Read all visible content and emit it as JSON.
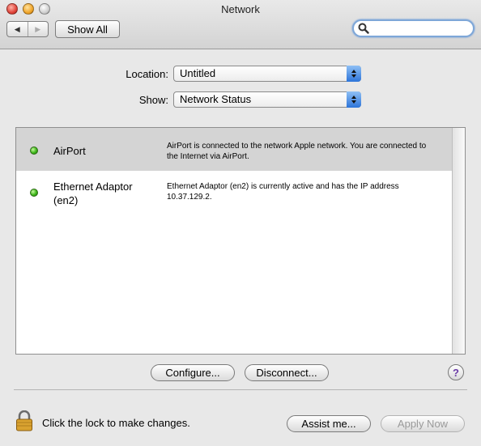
{
  "window": {
    "title": "Network"
  },
  "toolbar": {
    "back_arrow": "◀",
    "forward_arrow": "▶",
    "show_all_label": "Show All",
    "search_placeholder": ""
  },
  "location": {
    "label": "Location:",
    "value": "Untitled"
  },
  "show": {
    "label": "Show:",
    "value": "Network Status"
  },
  "status_list": [
    {
      "name": "AirPort",
      "status_color": "#3db81a",
      "description": "AirPort is connected to the network Apple network. You are connected to the Internet via AirPort.",
      "selected": true
    },
    {
      "name": "Ethernet Adaptor (en2)",
      "status_color": "#3db81a",
      "description": "Ethernet Adaptor (en2) is currently active and has the IP address 10.37.129.2.",
      "selected": false
    }
  ],
  "actions": {
    "configure_label": "Configure...",
    "disconnect_label": "Disconnect...",
    "help_label": "?"
  },
  "footer": {
    "lock_text": "Click the lock to make changes.",
    "assist_label": "Assist me...",
    "apply_label": "Apply Now"
  }
}
